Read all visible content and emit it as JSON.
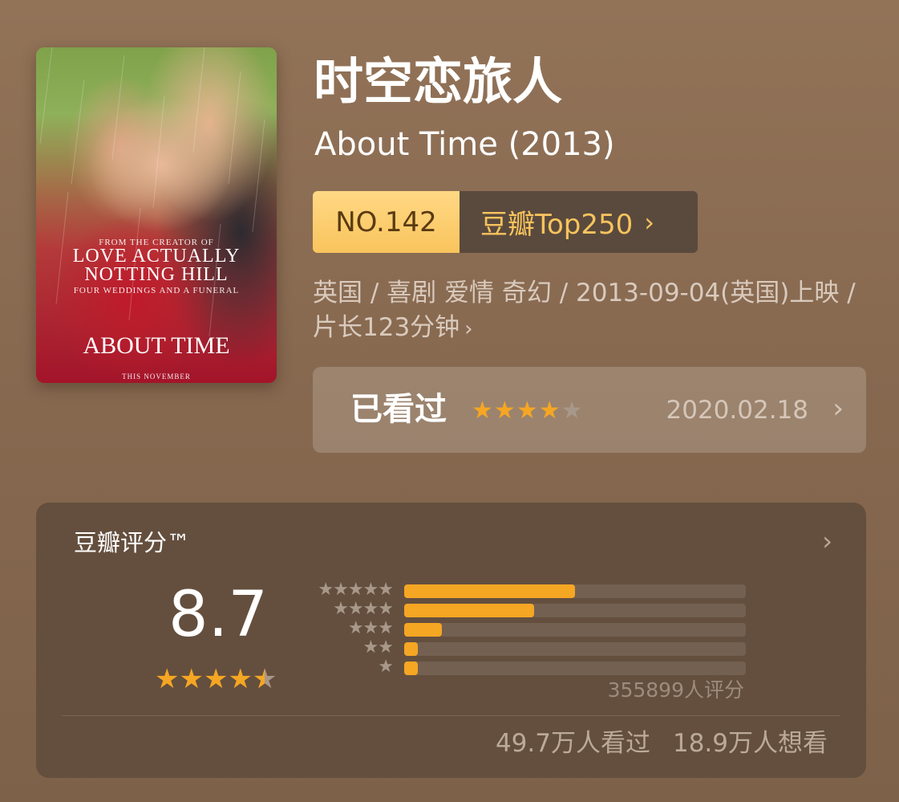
{
  "movie": {
    "title_cn": "时空恋旅人",
    "title_en": "About Time (2013)",
    "meta_line": "英国 / 喜剧 爱情 奇幻 / 2013-09-04(英国)上映 / 片长123分钟",
    "meta_chevron": "›"
  },
  "poster": {
    "tagline_small": "FROM THE CREATOR OF",
    "line1": "LOVE ACTUALLY",
    "line2": "NOTTING HILL",
    "line3": "FOUR WEDDINGS AND A FUNERAL",
    "title": "ABOUT TIME",
    "date": "THIS NOVEMBER"
  },
  "ranking": {
    "number": "NO.142",
    "list_label": "豆瓣Top250",
    "chevron": "›"
  },
  "seen": {
    "label": "已看过",
    "user_stars": 4,
    "max_stars": 5,
    "date": "2020.02.18",
    "chevron": "›"
  },
  "rating": {
    "title": "豆瓣评分™",
    "chevron": "›",
    "score": "8.7",
    "score_stars": 4.5,
    "distribution": [
      {
        "stars": 5,
        "fraction": 0.5
      },
      {
        "stars": 4,
        "fraction": 0.38
      },
      {
        "stars": 3,
        "fraction": 0.11
      },
      {
        "stars": 2,
        "fraction": 0.04
      },
      {
        "stars": 1,
        "fraction": 0.04
      }
    ],
    "rating_count": "355899人评分",
    "watched": "49.7万人看过",
    "want": "18.9万人想看"
  },
  "colors": {
    "accent_star": "#f5a623",
    "badge_gold": "#f9c45d"
  }
}
